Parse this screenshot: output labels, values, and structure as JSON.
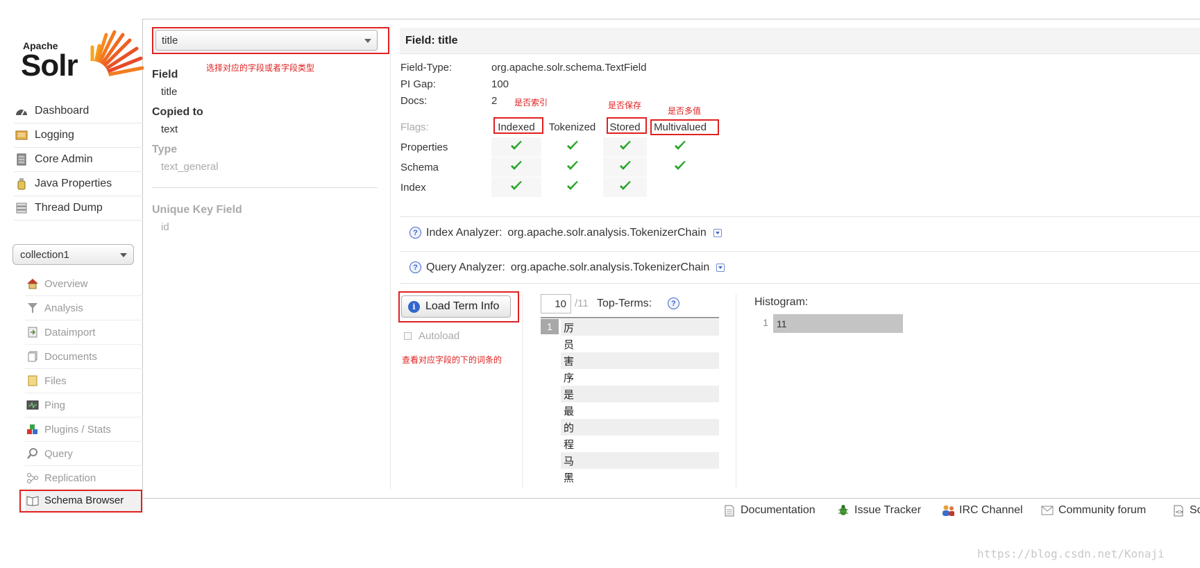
{
  "logo": {
    "apache": "Apache",
    "solr": "Solr"
  },
  "nav": {
    "items": [
      {
        "label": "Dashboard",
        "icon": "dashboard-icon"
      },
      {
        "label": "Logging",
        "icon": "logging-icon"
      },
      {
        "label": "Core Admin",
        "icon": "core-admin-icon"
      },
      {
        "label": "Java Properties",
        "icon": "java-properties-icon"
      },
      {
        "label": "Thread Dump",
        "icon": "thread-dump-icon"
      }
    ],
    "core_selector": "collection1",
    "core_items": [
      {
        "label": "Overview",
        "icon": "overview-icon"
      },
      {
        "label": "Analysis",
        "icon": "analysis-icon"
      },
      {
        "label": "Dataimport",
        "icon": "dataimport-icon"
      },
      {
        "label": "Documents",
        "icon": "documents-icon"
      },
      {
        "label": "Files",
        "icon": "files-icon"
      },
      {
        "label": "Ping",
        "icon": "ping-icon"
      },
      {
        "label": "Plugins / Stats",
        "icon": "plugins-icon"
      },
      {
        "label": "Query",
        "icon": "query-icon"
      },
      {
        "label": "Replication",
        "icon": "replication-icon"
      },
      {
        "label": "Schema Browser",
        "icon": "schema-browser-icon"
      }
    ]
  },
  "field_panel": {
    "selected": "title",
    "field_label": "Field",
    "field_value": "title",
    "copied_label": "Copied to",
    "copied_value": "text",
    "type_label": "Type",
    "type_value": "text_general",
    "unique_label": "Unique Key Field",
    "unique_value": "id"
  },
  "annotations": {
    "select_field": "选择对应的字段或者字段类型",
    "is_indexed": "是否索引",
    "is_stored": "是否保存",
    "is_multivalued": "是否多值",
    "view_terms": "查看对应字段的下的词条的"
  },
  "main": {
    "heading": "Field: title",
    "field_type_label": "Field-Type:",
    "field_type_value": "org.apache.solr.schema.TextField",
    "pi_gap_label": "PI Gap:",
    "pi_gap_value": "100",
    "docs_label": "Docs:",
    "docs_value": "2",
    "flags_label": "Flags:",
    "flag_headers": [
      "Indexed",
      "Tokenized",
      "Stored",
      "Multivalued"
    ],
    "flag_rows": [
      {
        "label": "Properties",
        "checks": [
          true,
          true,
          true,
          true
        ]
      },
      {
        "label": "Schema",
        "checks": [
          true,
          true,
          true,
          true
        ]
      },
      {
        "label": "Index",
        "checks": [
          true,
          true,
          true,
          false
        ]
      }
    ],
    "index_analyzer_label": "Index Analyzer:",
    "index_analyzer_value": "org.apache.solr.analysis.TokenizerChain",
    "query_analyzer_label": "Query Analyzer:",
    "query_analyzer_value": "org.apache.solr.analysis.TokenizerChain"
  },
  "terms": {
    "load_button": "Load Term Info",
    "autoload": "Autoload",
    "top_n": "10",
    "total": "/11",
    "top_terms_label": "Top-Terms:",
    "count": "1",
    "list": [
      "厉",
      "员",
      "害",
      "序",
      "是",
      "最",
      "的",
      "程",
      "马",
      "黑"
    ],
    "histogram_label": "Histogram:",
    "histogram": [
      {
        "key": "1",
        "value": "11"
      }
    ]
  },
  "footer": [
    {
      "label": "Documentation",
      "icon": "documentation-icon"
    },
    {
      "label": "Issue Tracker",
      "icon": "issue-tracker-icon"
    },
    {
      "label": "IRC Channel",
      "icon": "irc-channel-icon"
    },
    {
      "label": "Community forum",
      "icon": "community-forum-icon"
    },
    {
      "label": "So",
      "icon": "solr-query-syntax-icon"
    }
  ],
  "watermark": "https://blog.csdn.net/Konaji",
  "colors": {
    "annotation": "#e02020",
    "check": "#2aa52a",
    "accent": "#3366cc"
  }
}
